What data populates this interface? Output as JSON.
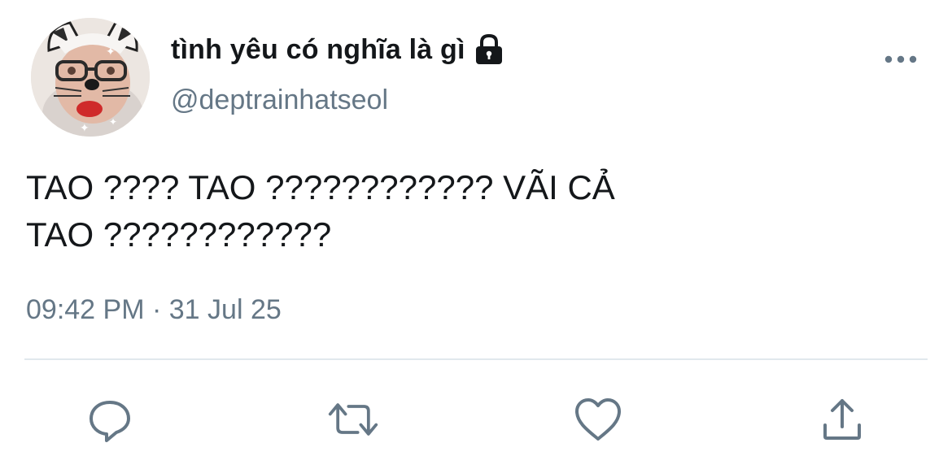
{
  "tweet": {
    "author": {
      "display_name": "tình yêu có nghĩa là gì",
      "handle": "@deptrainhatseol",
      "protected_icon": "lock-icon",
      "avatar_icon": "profile-photo"
    },
    "text_lines": [
      "TAO ???? TAO ???????????? VÃI CẢ",
      "TAO ????????????"
    ],
    "timestamp": {
      "time": "09:42 PM",
      "separator": "·",
      "date": "31 Jul 25"
    },
    "more_icon": "more-horizontal-icon",
    "actions": [
      {
        "icon": "reply-icon"
      },
      {
        "icon": "retweet-icon"
      },
      {
        "icon": "like-icon"
      },
      {
        "icon": "share-icon"
      }
    ]
  },
  "colors": {
    "text_primary": "#14171a",
    "text_secondary": "#657786",
    "icon_gray": "#657786",
    "divider": "#e1e8ed"
  }
}
